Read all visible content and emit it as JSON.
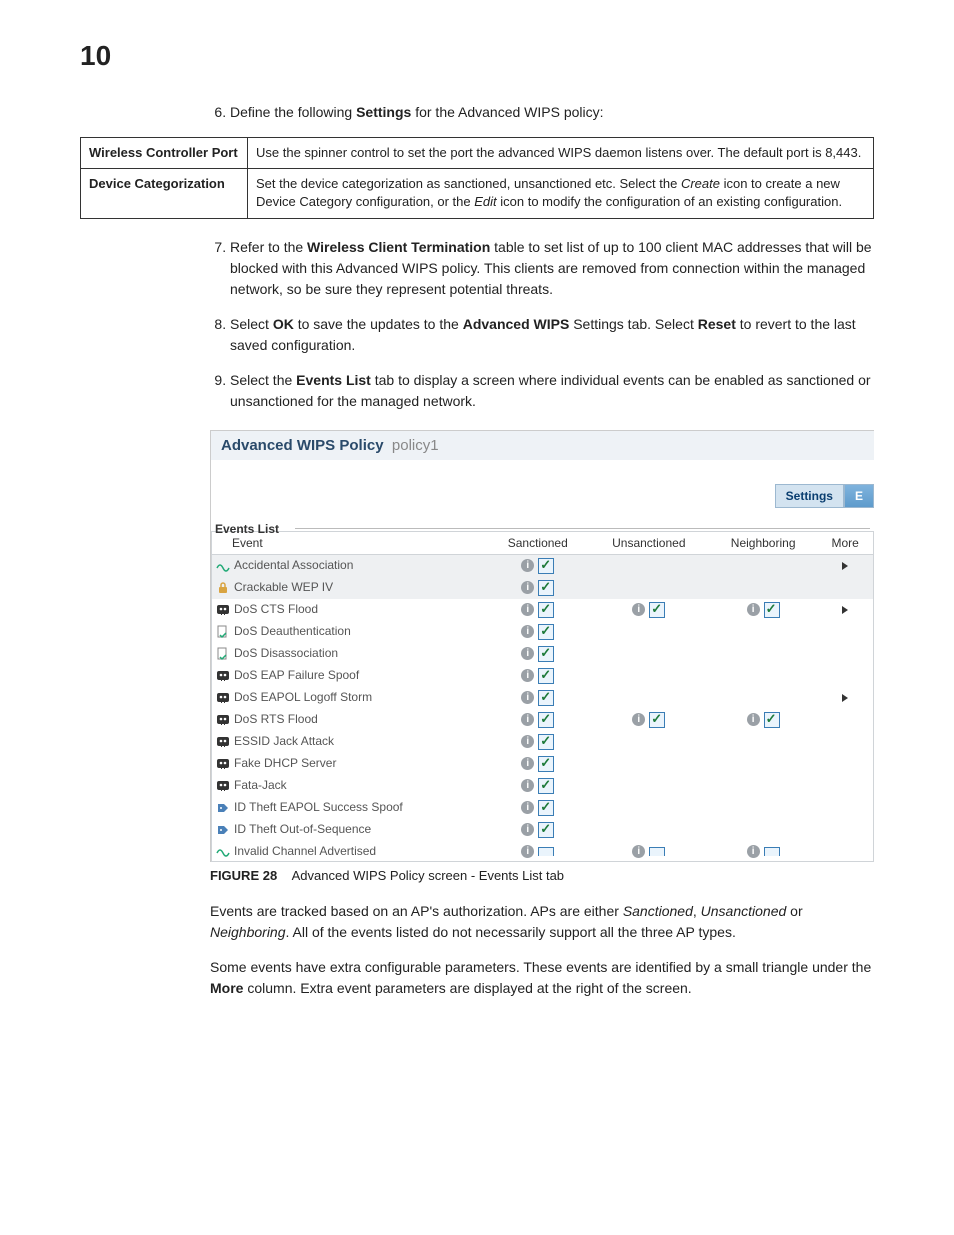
{
  "page_number": "10",
  "steps": {
    "s6_prefix": "Define the following ",
    "s6_bold": "Settings",
    "s6_suffix": " for the Advanced WIPS policy:",
    "s7_prefix": "Refer to the ",
    "s7_bold": "Wireless Client Termination",
    "s7_suffix": " table to set list of up to 100 client MAC addresses that will be blocked with this Advanced WIPS policy. This clients are removed from connection within the managed network, so be sure they represent potential threats.",
    "s8_a": "Select ",
    "s8_b": "OK",
    "s8_c": " to save the updates to the ",
    "s8_d": "Advanced WIPS",
    "s8_e": " Settings tab. Select ",
    "s8_f": "Reset",
    "s8_g": " to revert to the last saved configuration.",
    "s9_a": "Select the ",
    "s9_b": "Events List",
    "s9_c": " tab to display a screen where individual events can be enabled as sanctioned or unsanctioned for the managed network."
  },
  "settings_table": {
    "row1_label": "Wireless Controller Port",
    "row1_desc": "Use the spinner control to set the port the advanced WIPS daemon listens over. The default port is 8,443.",
    "row2_label": "Device Categorization",
    "row2_desc_a": "Set the device categorization as sanctioned, unsanctioned etc. Select the ",
    "row2_desc_b": "Create",
    "row2_desc_c": " icon to create a new Device Category configuration, or the ",
    "row2_desc_d": "Edit",
    "row2_desc_e": " icon to modify the configuration of an existing configuration."
  },
  "screenshot": {
    "title_strong": "Advanced WIPS Policy",
    "title_light": "policy1",
    "tab_settings": "Settings",
    "tab_events_partial": "E",
    "fieldset": "Events List",
    "headers": {
      "event": "Event",
      "sanctioned": "Sanctioned",
      "unsanctioned": "Unsanctioned",
      "neighboring": "Neighboring",
      "more": "More"
    },
    "rows": [
      {
        "name": "Accidental Association",
        "icon": "wave",
        "alt": true,
        "sanc": {
          "i": true,
          "c": true
        },
        "unsanc": {},
        "neigh": {},
        "more": true
      },
      {
        "name": "Crackable WEP IV",
        "icon": "lock",
        "alt": true,
        "sanc": {
          "i": true,
          "c": true
        },
        "unsanc": {},
        "neigh": {},
        "more": false
      },
      {
        "name": "DoS CTS Flood",
        "icon": "skull",
        "alt": false,
        "sanc": {
          "i": true,
          "c": true
        },
        "unsanc": {
          "i": true,
          "c": true
        },
        "neigh": {
          "i": true,
          "c": true
        },
        "more": true
      },
      {
        "name": "DoS Deauthentication",
        "icon": "doc",
        "alt": false,
        "sanc": {
          "i": true,
          "c": true
        },
        "unsanc": {},
        "neigh": {},
        "more": false
      },
      {
        "name": "DoS Disassociation",
        "icon": "doc",
        "alt": false,
        "sanc": {
          "i": true,
          "c": true
        },
        "unsanc": {},
        "neigh": {},
        "more": false
      },
      {
        "name": "DoS EAP Failure Spoof",
        "icon": "skull",
        "alt": false,
        "sanc": {
          "i": true,
          "c": true
        },
        "unsanc": {},
        "neigh": {},
        "more": false
      },
      {
        "name": "DoS EAPOL Logoff Storm",
        "icon": "skull",
        "alt": false,
        "sanc": {
          "i": true,
          "c": true
        },
        "unsanc": {},
        "neigh": {},
        "more": true
      },
      {
        "name": "DoS RTS Flood",
        "icon": "skull",
        "alt": false,
        "sanc": {
          "i": true,
          "c": true
        },
        "unsanc": {
          "i": true,
          "c": true
        },
        "neigh": {
          "i": true,
          "c": true
        },
        "more": false
      },
      {
        "name": "ESSID Jack Attack",
        "icon": "skull",
        "alt": false,
        "sanc": {
          "i": true,
          "c": true
        },
        "unsanc": {},
        "neigh": {},
        "more": false
      },
      {
        "name": "Fake DHCP Server",
        "icon": "skull",
        "alt": false,
        "sanc": {
          "i": true,
          "c": true
        },
        "unsanc": {},
        "neigh": {},
        "more": false
      },
      {
        "name": "Fata-Jack",
        "icon": "skull",
        "alt": false,
        "sanc": {
          "i": true,
          "c": true
        },
        "unsanc": {},
        "neigh": {},
        "more": false
      },
      {
        "name": "ID Theft EAPOL Success Spoof",
        "icon": "tag",
        "alt": false,
        "sanc": {
          "i": true,
          "c": true
        },
        "unsanc": {},
        "neigh": {},
        "more": false
      },
      {
        "name": "ID Theft Out-of-Sequence",
        "icon": "tag",
        "alt": false,
        "sanc": {
          "i": true,
          "c": true
        },
        "unsanc": {},
        "neigh": {},
        "more": false
      },
      {
        "name": "Invalid Channel Advertised",
        "icon": "wave",
        "alt": false,
        "sanc": {
          "i": true,
          "c": false,
          "partial": true
        },
        "unsanc": {
          "i": true,
          "c": false,
          "partial": true
        },
        "neigh": {
          "i": true,
          "c": false,
          "partial": true
        },
        "more": false
      }
    ]
  },
  "figure": {
    "label": "FIGURE 28",
    "caption": "Advanced WIPS Policy screen - Events List tab"
  },
  "para1_a": "Events are tracked based on an AP's authorization. APs are either ",
  "para1_b": "Sanctioned",
  "para1_c": ", ",
  "para1_d": "Unsanctioned",
  "para1_e": " or ",
  "para1_f": "Neighboring",
  "para1_g": ". All of the events listed do not necessarily support all the three AP types.",
  "para2_a": "Some events have extra configurable parameters. These events are identified by a small triangle under the ",
  "para2_b": "More",
  "para2_c": " column. Extra event parameters are displayed at the right of the screen."
}
